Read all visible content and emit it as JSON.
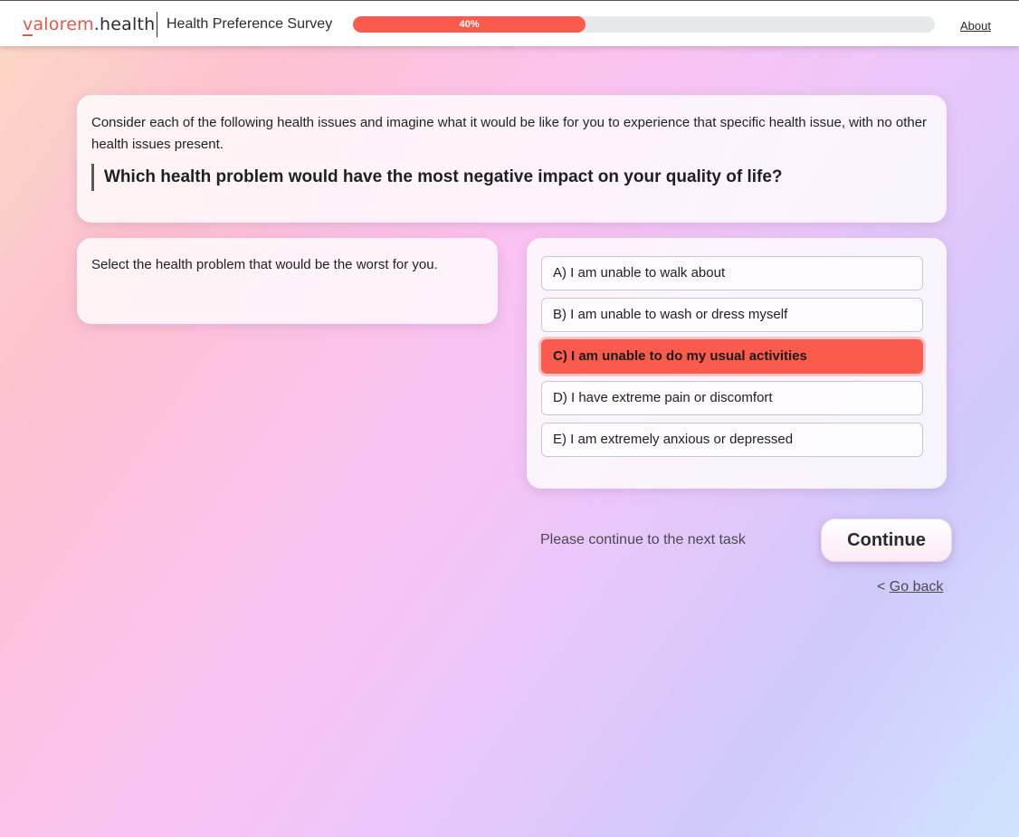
{
  "header": {
    "logo_brand": "alorem",
    "logo_v": "v",
    "logo_suffix": ".health",
    "survey_title": "Health Preference Survey",
    "progress_label": "40%",
    "progress_value": 40,
    "about_label": "About"
  },
  "question_card": {
    "intro": "Consider each of the following health issues and imagine what it would be like for you to experience that specific health issue, with no other health issues present.",
    "question": "Which health problem would have the most negative impact on your quality of life?"
  },
  "instruction": "Select the health problem that would be the worst for you.",
  "options": [
    {
      "label": "A) I am unable to walk about",
      "selected": false
    },
    {
      "label": "B) I am unable to wash or dress myself",
      "selected": false
    },
    {
      "label": "C) I am unable to do my usual activities",
      "selected": true
    },
    {
      "label": "D) I have extreme pain or discomfort",
      "selected": false
    },
    {
      "label": "E) I am extremely anxious or depressed",
      "selected": false
    }
  ],
  "footer": {
    "continue_message": "Please continue to the next task",
    "continue_label": "Continue",
    "back_prefix": "< ",
    "back_label": "Go back"
  },
  "colors": {
    "accent": "#fb5b4d",
    "brand": "#e2584a"
  }
}
